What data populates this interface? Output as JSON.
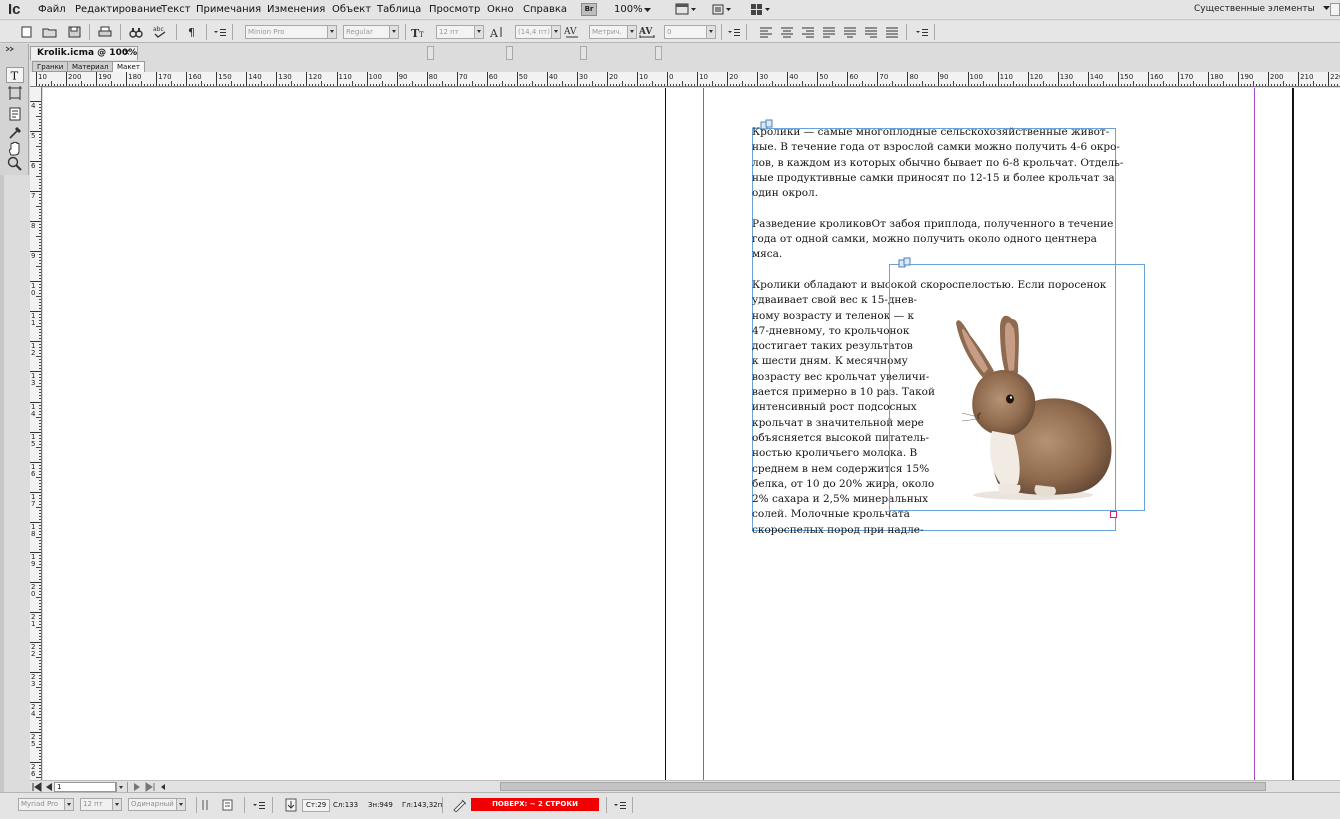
{
  "app": {
    "logo": "Ic"
  },
  "menu": {
    "items": [
      "Файл",
      "Редактирование",
      "Текст",
      "Примечания",
      "Изменения",
      "Объект",
      "Таблица",
      "Просмотр",
      "Окно",
      "Справка"
    ],
    "bridge_badge": "Br",
    "zoom": "100%",
    "workspace": "Существенные элементы"
  },
  "toolbar": {
    "font_family": "Minion Pro",
    "font_style": "Regular",
    "font_size": "12 пт",
    "leading": "(14,4 пт)",
    "kerning": "Метрич.",
    "tracking": "0"
  },
  "document": {
    "tab_title": "Krolik.icma @ 100%",
    "tab_close": "×",
    "view_tabs": [
      "Гранки",
      "Материал",
      "Макет"
    ],
    "active_view": "Макет"
  },
  "rulers": {
    "horizontal": [
      "10",
      "200",
      "190",
      "180",
      "170",
      "160",
      "150",
      "140",
      "130",
      "120",
      "110",
      "100",
      "90",
      "80",
      "70",
      "60",
      "50",
      "40",
      "30",
      "20",
      "10",
      "0",
      "10",
      "20",
      "30",
      "40",
      "50",
      "60",
      "70",
      "80",
      "90",
      "100",
      "110",
      "120",
      "130",
      "140",
      "150",
      "160",
      "170",
      "180",
      "190",
      "200",
      "210",
      "220"
    ],
    "vertical": [
      "4",
      "5",
      "6",
      "7",
      "8",
      "9",
      "10",
      "11",
      "12",
      "13",
      "14",
      "15",
      "16",
      "17",
      "18",
      "19",
      "20",
      "21",
      "22",
      "23",
      "24",
      "25",
      "26"
    ]
  },
  "story": {
    "lines": [
      "Кролики — самые многоплодные сельскохозяйственные живот-",
      "ные. В течение года от взрослой самки можно получить 4-6 окро-",
      "лов, в каждом из которых обычно бывает по 6-8 крольчат. Отдель-",
      "ные продуктивные самки приносят по 12-15 и более крольчат за",
      "один окрол.",
      "",
      "Разведение кроликовОт забоя приплода, полученного в течение",
      "года от одной самки, можно получить около одного центнера",
      "мяса.",
      "",
      "Кролики обладают и высокой скороспелостью. Если поросенок",
      "удваивает свой вес к 15-днев-",
      "ному возрасту и теленок — к",
      "47-дневному, то крольчонок",
      "достигает таких результатов",
      "к шести дням. К месячному",
      "возрасту вес крольчат увеличи-",
      "вается примерно в 10 раз. Такой",
      "интенсивный рост подсосных",
      "крольчат в значительной мере",
      "объясняется высокой питатель-",
      "ностью кроличьего молока. В",
      "среднем в нем содержится 15%",
      "белка, от 10 до 20% жира, около",
      "2% сахара и 2,5% минеральных",
      "солей. Молочные крольчата",
      "скороспелых пород при надле-"
    ]
  },
  "status": {
    "font_family": "Myriad Pro",
    "font_size": "12 пт",
    "mode": "Одинарный",
    "line": "Ст:29",
    "words": "Сл:133",
    "chars": "Зн:949",
    "depth": "Гл:143,32п",
    "overset": "ПОВЕРХ: ~ 2 СТРОКИ"
  },
  "pager": {
    "page": "1"
  },
  "colors": {
    "overset_badge": "#f00000",
    "margin_guide": "#a64ac9",
    "frame_border": "#6aa3d8"
  },
  "icons": [
    "bunny-image"
  ]
}
